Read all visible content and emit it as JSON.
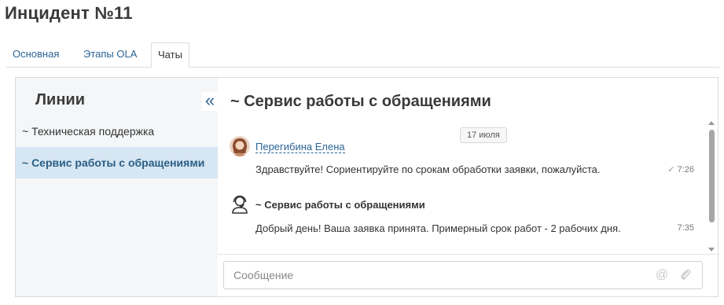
{
  "page": {
    "title": "Инцидент №11"
  },
  "tabs": [
    {
      "label": "Основная",
      "active": false
    },
    {
      "label": "Этапы OLA",
      "active": false
    },
    {
      "label": "Чаты",
      "active": true
    }
  ],
  "sidebar": {
    "title": "Линии",
    "collapse_icon": "double-chevron-left-icon",
    "lines": [
      {
        "label": "~ Техническая поддержка",
        "active": false
      },
      {
        "label": "~ Сервис работы с обращениями",
        "active": true
      }
    ]
  },
  "chat": {
    "title": "~ Сервис работы с обращениями",
    "date_badge": "17 июля",
    "messages": [
      {
        "author": "Перегибина Елена",
        "avatar": "user-avatar",
        "text": "Здравствуйте! Сориентируйте по срокам обработки заявки, пожалуйста.",
        "time": "7:26",
        "status_icon": "checkmark-icon"
      },
      {
        "author": "~ Сервис работы с обращениями",
        "avatar": "headset-operator-icon",
        "text": "Добрый день! Ваша заявка принята. Примерный срок работ - 2 рабочих дня.",
        "time": "7:35"
      }
    ],
    "composer": {
      "placeholder": "Сообщение",
      "value": "",
      "mention_icon": "at-icon",
      "attach_icon": "paperclip-icon"
    }
  },
  "colors": {
    "link": "#2a6496",
    "sidebar_bg": "#f4f6f8",
    "active_line_bg": "#d6e6f2"
  }
}
